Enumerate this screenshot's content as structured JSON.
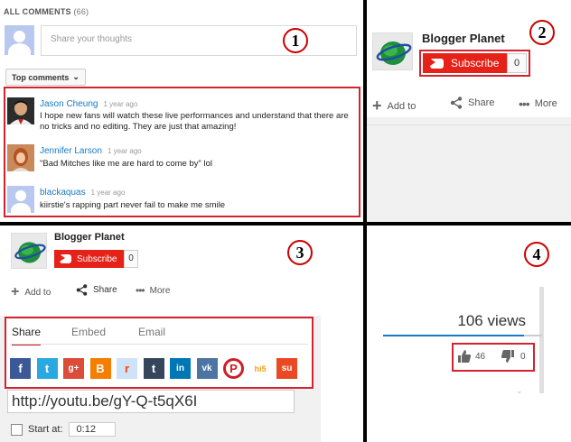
{
  "panel1": {
    "marker": "1",
    "title": "ALL COMMENTS",
    "count": "(66)",
    "share_placeholder": "Share your thoughts",
    "sort_label": "Top comments",
    "comments": [
      {
        "author": "Jason Cheung",
        "time": "1 year ago",
        "text": "I hope new fans will watch these live performances and understand that there are no tricks and no editing. They are just that amazing!"
      },
      {
        "author": "Jennifer Larson",
        "time": "1 year ago",
        "text": "\"Bad Mitches like me are hard to come by\" lol"
      },
      {
        "author": "blackaquas",
        "time": "1 year ago",
        "text": "kiirstie's rapping part never fail to make me smile"
      }
    ]
  },
  "panel2": {
    "marker": "2",
    "channel": "Blogger Planet",
    "subscribe": "Subscribe",
    "sub_count": "0",
    "actions": [
      "Add to",
      "Share",
      "More"
    ]
  },
  "panel3": {
    "marker": "3",
    "channel": "Blogger Planet",
    "subscribe": "Subscribe",
    "sub_count": "0",
    "actions": [
      "Add to",
      "Share",
      "More"
    ],
    "tabs": [
      "Share",
      "Embed",
      "Email"
    ],
    "social": [
      {
        "name": "facebook",
        "glyph": "f",
        "color": "#3b5998"
      },
      {
        "name": "twitter",
        "glyph": "t",
        "color": "#2aa9e0"
      },
      {
        "name": "google-plus",
        "glyph": "g+",
        "color": "#dd4b39"
      },
      {
        "name": "blogger",
        "glyph": "B",
        "color": "#f57d00"
      },
      {
        "name": "reddit",
        "glyph": "r",
        "color": "#cee3f8"
      },
      {
        "name": "tumblr",
        "glyph": "t",
        "color": "#35465c"
      },
      {
        "name": "linkedin",
        "glyph": "in",
        "color": "#0077b5"
      },
      {
        "name": "vk",
        "glyph": "vk",
        "color": "#4c75a3"
      },
      {
        "name": "pinterest",
        "glyph": "P",
        "color": "#cb2027"
      },
      {
        "name": "hi5",
        "glyph": "hi5",
        "color": "#f8a11b"
      },
      {
        "name": "stumbleupon",
        "glyph": "su",
        "color": "#eb4924"
      }
    ],
    "url": "http://youtu.be/gY-Q-t5qX6I",
    "start_label": "Start at:",
    "start_value": "0:12"
  },
  "panel4": {
    "marker": "4",
    "views": "106 views",
    "likes": "46",
    "dislikes": "0"
  }
}
